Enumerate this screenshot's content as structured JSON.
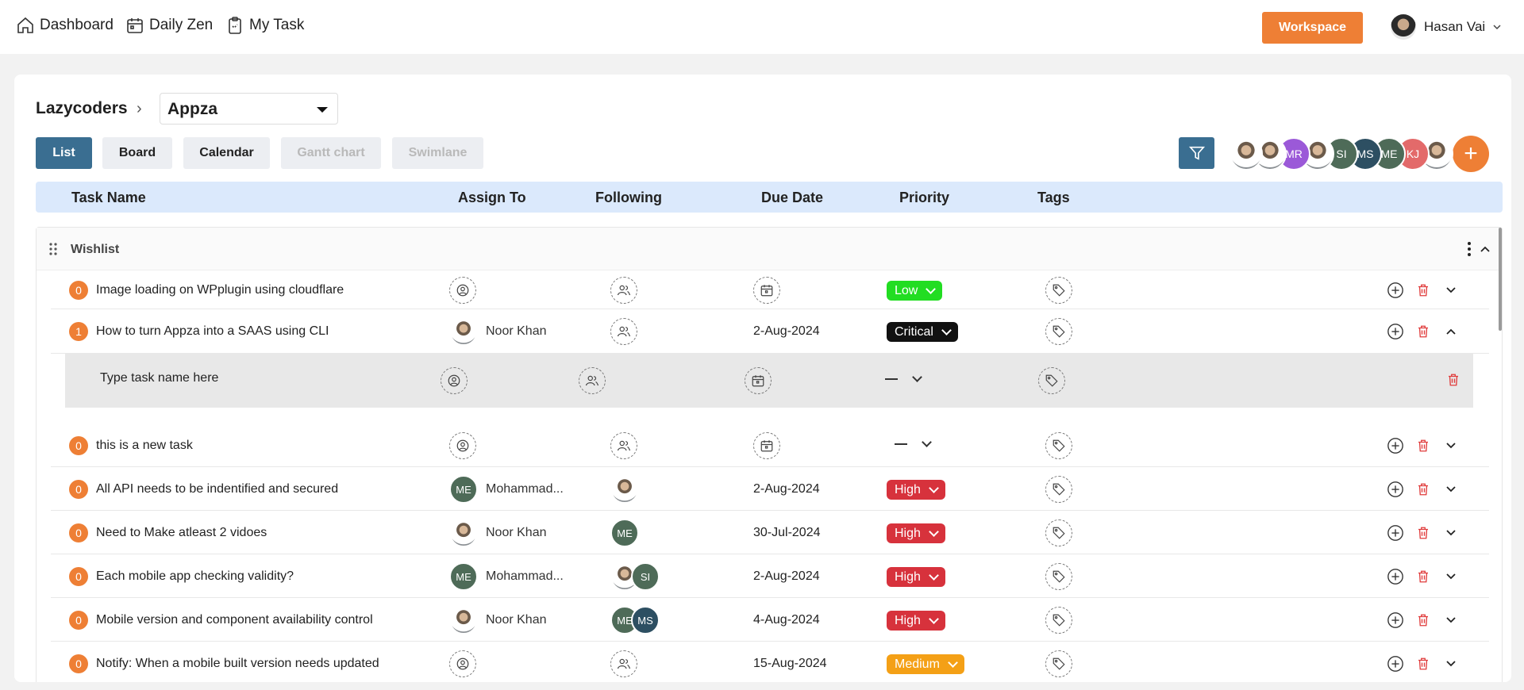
{
  "topnav": {
    "items": [
      {
        "label": "Dashboard",
        "icon": "home-icon"
      },
      {
        "label": "Daily Zen",
        "icon": "calendar-icon"
      },
      {
        "label": "My Task",
        "icon": "clipboard-icon"
      }
    ],
    "workspace_label": "Workspace",
    "user_name": "Hasan Vai"
  },
  "breadcrumb": {
    "org": "Lazycoders",
    "project": "Appza"
  },
  "views": [
    "List",
    "Board",
    "Calendar",
    "Gantt chart",
    "Swimlane"
  ],
  "active_view": "List",
  "members": [
    {
      "initials": "",
      "color": "photo"
    },
    {
      "initials": "",
      "color": "photo"
    },
    {
      "initials": "MR",
      "color": "#9b59d8"
    },
    {
      "initials": "",
      "color": "photo"
    },
    {
      "initials": "SI",
      "color": "#4e6b58"
    },
    {
      "initials": "MS",
      "color": "#2d4f62"
    },
    {
      "initials": "ME",
      "color": "#4e6b58"
    },
    {
      "initials": "KJ",
      "color": "#e36a6a"
    },
    {
      "initials": "",
      "color": "photo"
    }
  ],
  "columns": {
    "task_name": "Task Name",
    "assign_to": "Assign To",
    "following": "Following",
    "due_date": "Due Date",
    "priority": "Priority",
    "tags": "Tags"
  },
  "group": {
    "title": "Wishlist"
  },
  "new_task_placeholder": "Type task name here",
  "tasks": [
    {
      "count": "0",
      "name": "Image loading on WPplugin using cloudflare",
      "assignee": "",
      "due": "",
      "priority": "Low"
    },
    {
      "count": "1",
      "name": "How to turn Appza into a SAAS using CLI",
      "assignee": "Noor Khan",
      "due": "2-Aug-2024",
      "priority": "Critical"
    },
    {
      "count": "0",
      "name": "this is a new task",
      "assignee": "",
      "due": "",
      "priority": ""
    },
    {
      "count": "0",
      "name": "All API needs to be indentified and secured",
      "assignee": "Mohammad...",
      "assignee_initials": "ME",
      "due": "2-Aug-2024",
      "priority": "High"
    },
    {
      "count": "0",
      "name": "Need to Make atleast 2 vidoes",
      "assignee": "Noor Khan",
      "due": "30-Jul-2024",
      "priority": "High",
      "following_initials": "ME"
    },
    {
      "count": "0",
      "name": "Each mobile app checking validity?",
      "assignee": "Mohammad...",
      "assignee_initials": "ME",
      "due": "2-Aug-2024",
      "priority": "High",
      "following_initials": "SI"
    },
    {
      "count": "0",
      "name": "Mobile version and component availability control",
      "assignee": "Noor Khan",
      "due": "4-Aug-2024",
      "priority": "High",
      "following_initials": [
        "ME",
        "MS"
      ]
    },
    {
      "count": "0",
      "name": "Notify: When a mobile built version needs updated",
      "assignee": "",
      "due": "15-Aug-2024",
      "priority": "Medium"
    }
  ]
}
